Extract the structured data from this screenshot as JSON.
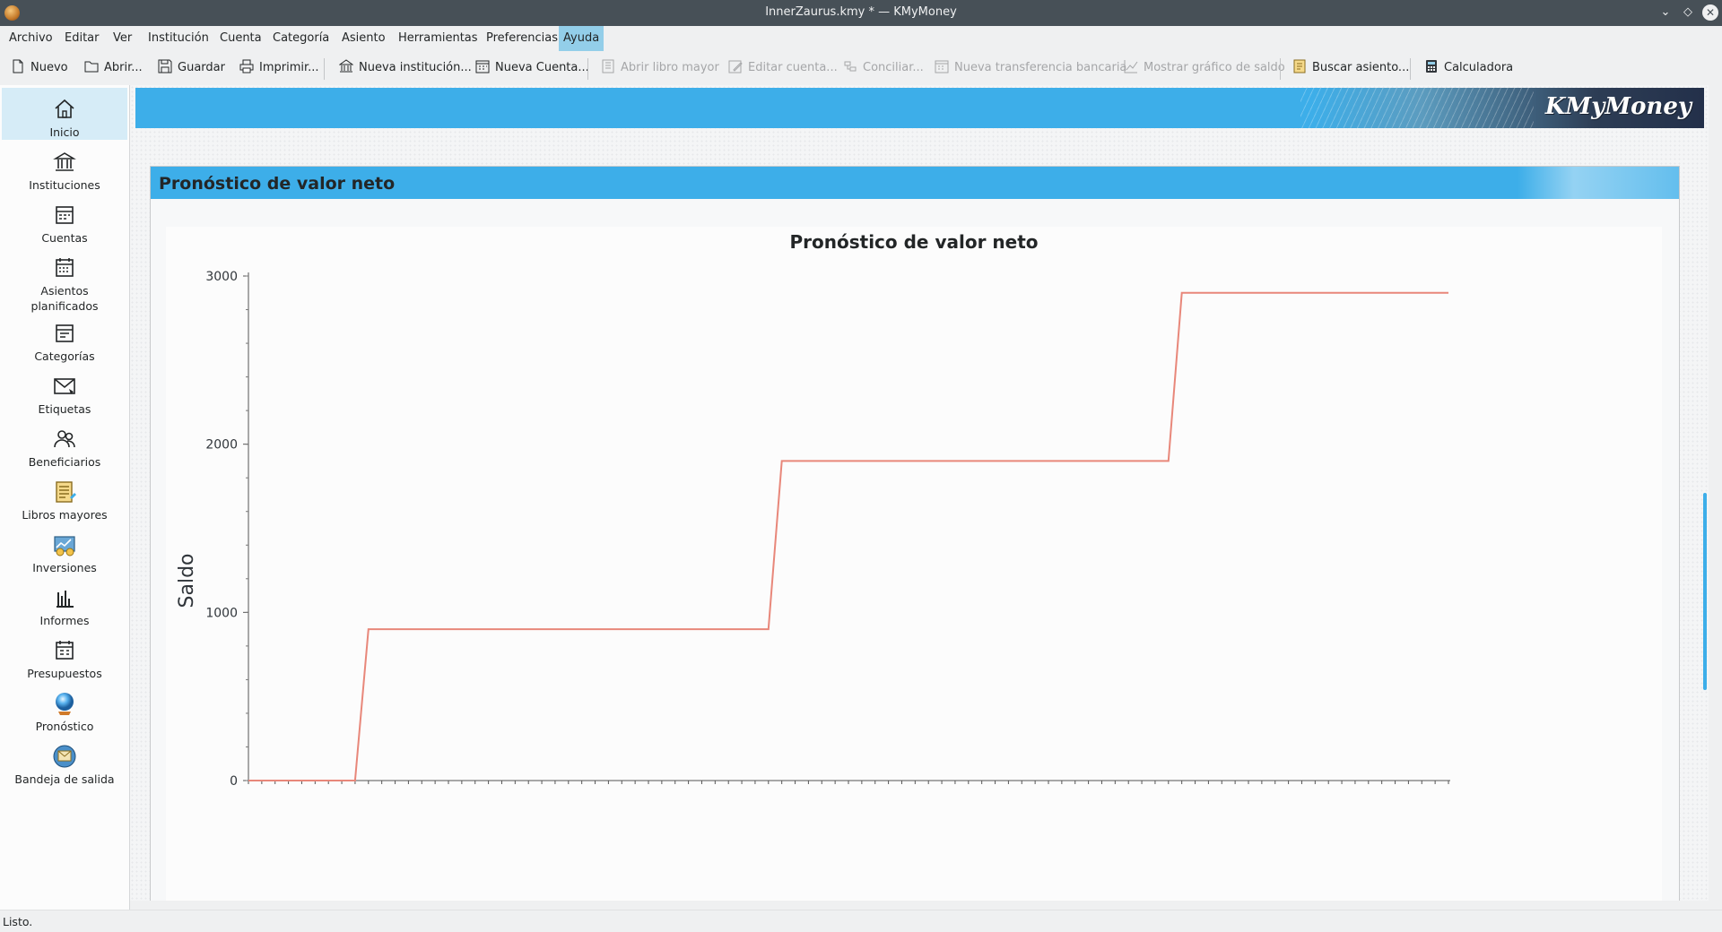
{
  "window": {
    "title": "InnerZaurus.kmy * — KMyMoney"
  },
  "menu": [
    "Archivo",
    "Editar",
    "Ver",
    "Institución",
    "Cuenta",
    "Categoría",
    "Asiento",
    "Herramientas",
    "Preferencias",
    "Ayuda"
  ],
  "menu_active": "Ayuda",
  "toolbar": {
    "nuevo": "Nuevo",
    "abrir": "Abrir...",
    "guardar": "Guardar",
    "imprimir": "Imprimir...",
    "nueva_institucion": "Nueva institución...",
    "nueva_cuenta": "Nueva Cuenta...",
    "abrir_libro": "Abrir libro mayor",
    "editar_cuenta": "Editar cuenta...",
    "conciliar": "Conciliar...",
    "nueva_transferencia": "Nueva transferencia bancaria",
    "mostrar_grafico": "Mostrar gráfico de saldo",
    "buscar_asiento": "Buscar asiento...",
    "calculadora": "Calculadora"
  },
  "sidebar": {
    "items": [
      {
        "label": "Inicio",
        "icon": "home-icon",
        "selected": true
      },
      {
        "label": "Instituciones",
        "icon": "bank-icon"
      },
      {
        "label": "Cuentas",
        "icon": "accounts-icon"
      },
      {
        "label": "Asientos\nplanificados",
        "icon": "schedule-icon"
      },
      {
        "label": "Categorías",
        "icon": "categories-icon"
      },
      {
        "label": "Etiquetas",
        "icon": "tag-envelope-icon"
      },
      {
        "label": "Beneficiarios",
        "icon": "payees-icon"
      },
      {
        "label": "Libros mayores",
        "icon": "ledger-icon"
      },
      {
        "label": "Inversiones",
        "icon": "investments-icon"
      },
      {
        "label": "Informes",
        "icon": "reports-icon"
      },
      {
        "label": "Presupuestos",
        "icon": "budget-icon"
      },
      {
        "label": "Pronóstico",
        "icon": "crystal-ball-icon"
      },
      {
        "label": "Bandeja de salida",
        "icon": "outbox-icon"
      }
    ]
  },
  "banner": {
    "logo": "KMyMoney"
  },
  "panel": {
    "title": "Pronóstico de valor neto"
  },
  "chart_data": {
    "type": "line",
    "title": "Pronóstico de valor neto",
    "xlabel": "",
    "ylabel": "Saldo",
    "ylim": [
      0,
      3000
    ],
    "yticks": [
      0,
      1000,
      2000,
      3000
    ],
    "grid": false,
    "color": "#e8877a",
    "series": [
      {
        "points": [
          [
            0,
            0
          ],
          [
            8,
            0
          ],
          [
            9,
            900
          ],
          [
            39,
            900
          ],
          [
            40,
            1900
          ],
          [
            69,
            1900
          ],
          [
            70,
            2900
          ],
          [
            90,
            2900
          ]
        ]
      }
    ],
    "x_range": [
      0,
      90
    ]
  },
  "status": "Listo."
}
